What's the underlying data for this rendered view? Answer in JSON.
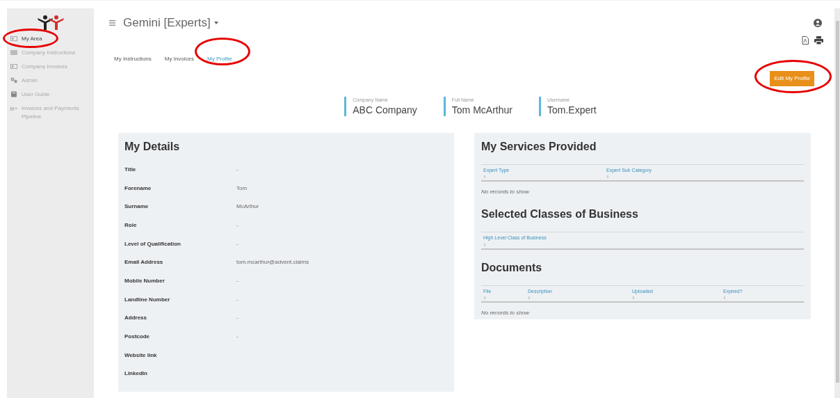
{
  "sidebar": {
    "items": [
      {
        "label": "My Area",
        "selected": true,
        "circled": true
      },
      {
        "label": "Company Instructions",
        "selected": false,
        "circled": false
      },
      {
        "label": "Company Invoices",
        "selected": false,
        "circled": false
      },
      {
        "label": "Admin",
        "selected": false,
        "circled": false
      },
      {
        "label": "User Guide",
        "selected": false,
        "circled": false
      },
      {
        "label": "Invoices and Payments Pipeline",
        "selected": false,
        "circled": false
      }
    ]
  },
  "header": {
    "title": "Gemini [Experts]"
  },
  "tabs": [
    {
      "label": "My Instructions",
      "selected": false,
      "circled": false
    },
    {
      "label": "My Invoices",
      "selected": false,
      "circled": false
    },
    {
      "label": "My Profile",
      "selected": true,
      "circled": true
    }
  ],
  "edit_button": {
    "label": "Edit My Profile",
    "circled": true
  },
  "summary": [
    {
      "label": "Company Name",
      "value": "ABC Company"
    },
    {
      "label": "Full Name",
      "value": "Tom McArthur"
    },
    {
      "label": "Username",
      "value": "Tom.Expert"
    }
  ],
  "details": {
    "title": "My Details",
    "rows": [
      {
        "label": "Title",
        "value": "-"
      },
      {
        "label": "Forename",
        "value": "Tom"
      },
      {
        "label": "Surname",
        "value": "McArthur"
      },
      {
        "label": "Role",
        "value": "-"
      },
      {
        "label": "Level of Qualification",
        "value": "-"
      },
      {
        "label": "Email Address",
        "value": "tom.mcarthur@advent.claims"
      },
      {
        "label": "Mobile Number",
        "value": "-"
      },
      {
        "label": "Landline Number",
        "value": "-"
      },
      {
        "label": "Address",
        "value": "-"
      },
      {
        "label": "Postcode",
        "value": "-"
      },
      {
        "label": "Website link"
      },
      {
        "label": "LinkedIn"
      }
    ]
  },
  "sections": [
    {
      "title": "My Services Provided",
      "columns": [
        "Expert Type",
        "Expert Sub Category"
      ],
      "empty_message": "No records to show"
    },
    {
      "title": "Selected Classes of Business",
      "columns": [
        "High Level Class of Business"
      ]
    },
    {
      "title": "Documents",
      "columns": [
        "File",
        "Description",
        "Uploaded",
        "Expired?"
      ],
      "empty_message": "No records to show"
    }
  ]
}
